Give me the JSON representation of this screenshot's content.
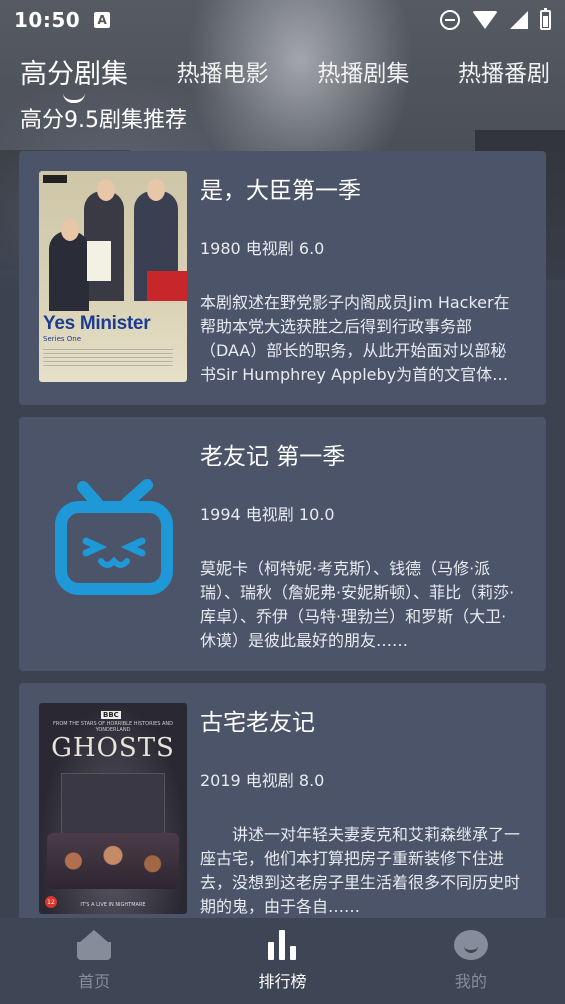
{
  "status_bar": {
    "time": "10:50",
    "notification_badge": "A",
    "icons": [
      "dnd-icon",
      "wifi-icon",
      "signal-icon",
      "battery-icon"
    ]
  },
  "tabs": [
    {
      "label": "高分剧集",
      "active": true
    },
    {
      "label": "热播电影",
      "active": false
    },
    {
      "label": "热播剧集",
      "active": false
    },
    {
      "label": "热播番剧",
      "active": false
    }
  ],
  "section_title": "高分9.5剧集推荐",
  "items": [
    {
      "title": "是，大臣第一季",
      "meta": "1980 电视剧 6.0",
      "description": "本剧叙述在野党影子内阁成员Jim Hacker在帮助本党大选获胜之后得到行政事务部（DAA）部长的职务，从此开始面对以部秘书Sir Humphrey Appleby为首的文官体系……",
      "poster": {
        "title": "Yes Minister",
        "subtitle": "Series One",
        "badge": "BBC"
      }
    },
    {
      "title": "老友记 第一季",
      "meta": "1994 电视剧 10.0",
      "description": "莫妮卡（柯特妮·考克斯）、钱德（马修·派瑞）、瑞秋（詹妮弗·安妮斯顿）、菲比（莉莎·库卓）、乔伊（马特·理勃兰）和罗斯（大卫·休谟）是彼此最好的朋友……",
      "poster": {
        "icon": "tv-placeholder-icon",
        "color": "#1e98d7"
      }
    },
    {
      "title": "古宅老友记",
      "meta": "2019 电视剧 8.0",
      "description": "　　讲述一对年轻夫妻麦克和艾莉森继承了一座古宅，他们本打算把房子重新装修下住进去，没想到这老房子里生活着很多不同历史时期的鬼，由于各自……",
      "poster": {
        "title": "GHOSTS",
        "badge": "BBC",
        "top_text": "FROM THE STARS OF HORRIBLE HISTORIES AND YONDERLAND",
        "tagline": "IT'S A LIVE IN NIGHTMARE",
        "rating": "12"
      }
    }
  ],
  "bottom_nav": [
    {
      "label": "首页",
      "icon": "home-icon",
      "active": false
    },
    {
      "label": "排行榜",
      "icon": "ranking-bar-chart-icon",
      "active": true
    },
    {
      "label": "我的",
      "icon": "profile-face-icon",
      "active": false
    }
  ]
}
